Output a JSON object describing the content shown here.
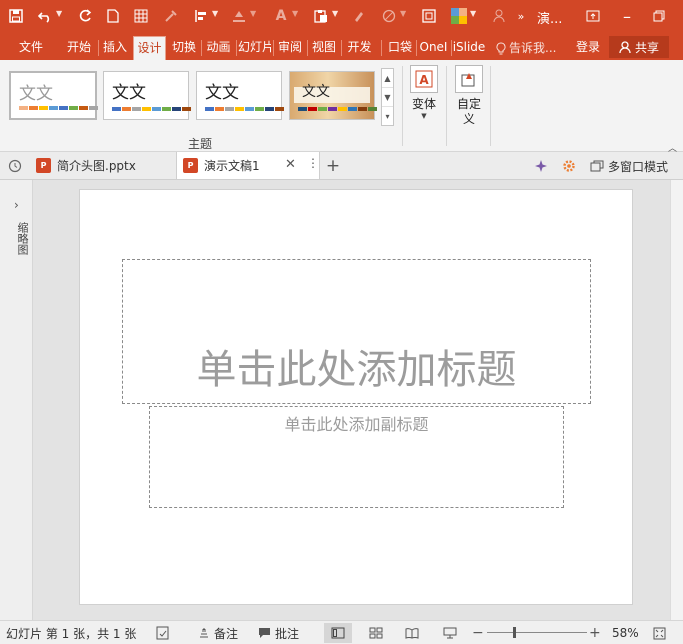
{
  "qat": {
    "icons": [
      "save-icon",
      "undo-icon",
      "redo-icon",
      "new-doc-icon",
      "grid-icon",
      "eyedropper-icon",
      "align-icon",
      "fill-icon",
      "font-color-icon",
      "paste-icon",
      "format-painter-icon",
      "shapes-icon",
      "fit-icon",
      "color-swatch-icon",
      "person-icon",
      "more-icon"
    ],
    "title": "演..."
  },
  "tabs": [
    "文件",
    "开始",
    "插入",
    "设计",
    "切换",
    "动画",
    "幻灯片",
    "审阅",
    "视图",
    "开发",
    "口袋",
    "OneI",
    "iSlide"
  ],
  "active_tab": "设计",
  "tell_me": "告诉我...",
  "login": "登录",
  "share": "共享",
  "themes": [
    {
      "label": "文文",
      "colors": [
        "#f4b183",
        "#ed7d31",
        "#ffc000",
        "#5b9bd5",
        "#4472c4",
        "#70ad47",
        "#c55a11",
        "#a5a5a5"
      ]
    },
    {
      "label": "文文",
      "colors": [
        "#4472c4",
        "#ed7d31",
        "#a5a5a5",
        "#ffc000",
        "#5b9bd5",
        "#70ad47",
        "#264478",
        "#9e480e"
      ]
    },
    {
      "label": "文文",
      "colors": [
        "#4472c4",
        "#ed7d31",
        "#a5a5a5",
        "#ffc000",
        "#5b9bd5",
        "#70ad47",
        "#264478",
        "#9e480e"
      ]
    },
    {
      "label": "文文",
      "colors": [
        "#1f4e79",
        "#c00000",
        "#70ad47",
        "#7030a0",
        "#ffc000",
        "#2e75b6",
        "#843c0c",
        "#548235"
      ]
    }
  ],
  "group_label": "主题",
  "variant_label": "变体",
  "custom_label": "自定义",
  "doc_tabs": [
    {
      "name": "简介头图.pptx",
      "active": false
    },
    {
      "name": "演示文稿1",
      "active": true
    }
  ],
  "multi_window": "多窗口模式",
  "left_pane_label": "缩略图",
  "slide": {
    "title_placeholder": "单击此处添加标题",
    "subtitle_placeholder": "单击此处添加副标题"
  },
  "status": {
    "slide_info": "幻灯片 第 1 张，共 1 张",
    "notes": "备注",
    "comments": "批注",
    "zoom": "58%",
    "zoom_fraction": 0.58
  },
  "colors": {
    "accent": "#d24726",
    "ribbon_bg": "#f3f3f3"
  }
}
